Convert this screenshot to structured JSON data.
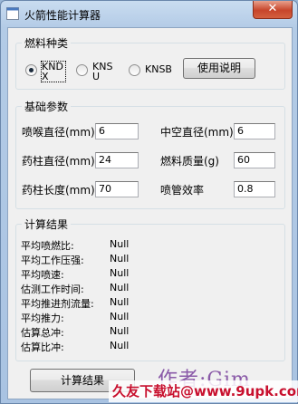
{
  "window": {
    "title": "火箭性能计算器",
    "close_label": "✕"
  },
  "fuel_group": {
    "legend": "燃料种类",
    "options": [
      "KNDX",
      "KNSU",
      "KNSB"
    ],
    "selected": "KNDX",
    "help_button": "使用说明"
  },
  "params_group": {
    "legend": "基础参数",
    "fields": [
      {
        "label": "喷喉直径(mm)",
        "value": "6"
      },
      {
        "label": "中空直径(mm)",
        "value": "6"
      },
      {
        "label": "药柱直径(mm)",
        "value": "24"
      },
      {
        "label": "燃料质量(g)",
        "value": "60"
      },
      {
        "label": "药柱长度(mm)",
        "value": "70"
      },
      {
        "label": "喷管效率",
        "value": "0.8"
      }
    ]
  },
  "results_group": {
    "legend": "计算结果",
    "rows": [
      {
        "label": "平均喷燃比:",
        "value": "Null"
      },
      {
        "label": "平均工作压强:",
        "value": "Null"
      },
      {
        "label": "平均喷速:",
        "value": "Null"
      },
      {
        "label": "估测工作时间:",
        "value": "Null"
      },
      {
        "label": "平均推进剂流量:",
        "value": "Null"
      },
      {
        "label": "平均推力:",
        "value": "Null"
      },
      {
        "label": "估算总冲:",
        "value": "Null"
      },
      {
        "label": "估算比冲:",
        "value": "Null"
      }
    ]
  },
  "calc_button": "计算结果",
  "author_text": "作者:Gim",
  "watermark_text": "久友下载站@www.9upk.com"
}
